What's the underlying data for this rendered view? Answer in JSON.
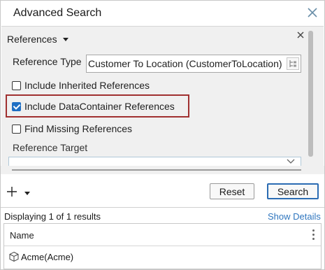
{
  "window": {
    "title": "Advanced Search"
  },
  "section": {
    "title": "References"
  },
  "reference_type": {
    "label": "Reference Type",
    "value": "Customer To Location (CustomerToLocation)"
  },
  "options": [
    {
      "label": "Include Inherited References",
      "checked": false
    },
    {
      "label": "Include DataContainer References",
      "checked": true
    },
    {
      "label": "Find Missing References",
      "checked": false
    }
  ],
  "reference_target": {
    "label": "Reference Target"
  },
  "buttons": {
    "reset": "Reset",
    "search": "Search"
  },
  "results": {
    "summary": "Displaying 1 of 1 results",
    "show_details": "Show Details",
    "columns": [
      "Name"
    ],
    "rows": [
      {
        "name": "Acme",
        "detail": "(Acme)"
      }
    ]
  },
  "colors": {
    "accent": "#2b6cb3",
    "highlight": "#a03030",
    "link": "#2f76bf"
  },
  "icons": [
    "close-icon",
    "caret-down-icon",
    "tree-picker-icon",
    "add-icon",
    "column-menu-icon",
    "cube-icon",
    "checkbox-checked-icon"
  ]
}
